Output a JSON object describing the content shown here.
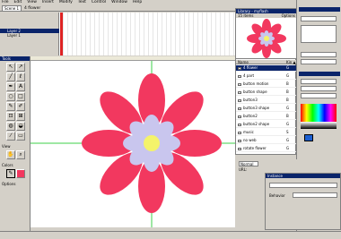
{
  "menu": [
    "File",
    "Edit",
    "View",
    "Insert",
    "Modify",
    "Text",
    "Control",
    "Window",
    "Help"
  ],
  "docbar": {
    "scene": "Scene 1",
    "symbol": "4 flower"
  },
  "timeline": {
    "layers": [
      "Layer 2",
      "Layer 1"
    ]
  },
  "tools": {
    "title": "Tools",
    "sections": [
      "View",
      "Colors",
      "Options"
    ]
  },
  "library": {
    "title": "Library - myflash",
    "count": "15 items",
    "options": "Options",
    "column_name": "Name",
    "column_kind": "Kin ▲",
    "items": [
      {
        "name": "4 flower",
        "kind": "G"
      },
      {
        "name": "4 part",
        "kind": "G"
      },
      {
        "name": "button motion",
        "kind": "B"
      },
      {
        "name": "button shape",
        "kind": "B"
      },
      {
        "name": "button3",
        "kind": "B"
      },
      {
        "name": "button3 shape",
        "kind": "G"
      },
      {
        "name": "button2",
        "kind": "B"
      },
      {
        "name": "button2 shape",
        "kind": "G"
      },
      {
        "name": "music",
        "kind": "S"
      },
      {
        "name": "no web",
        "kind": "G"
      },
      {
        "name": "rotate flower",
        "kind": "G"
      }
    ]
  },
  "props": {
    "blend": "Normal",
    "label": "URL:"
  },
  "instance": {
    "title": "Instance",
    "behavior": "Behavior"
  },
  "colors": {
    "petal": "#f2385f",
    "inner": "#c9c6ee",
    "center": "#f4f36a",
    "guide": "#3cd24a",
    "accent": "#0a246a"
  }
}
